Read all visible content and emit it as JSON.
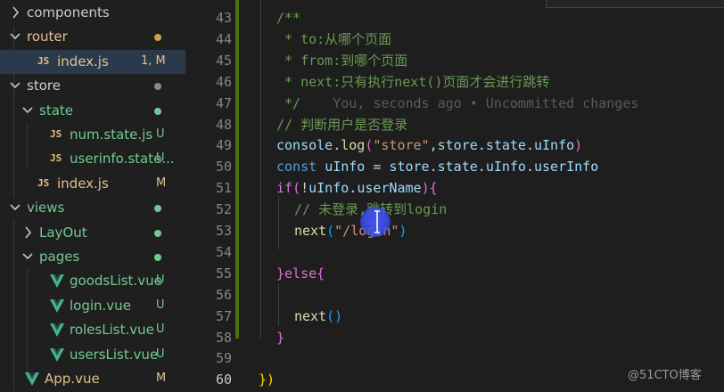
{
  "explorer": {
    "items": [
      {
        "label": "components",
        "kind": "folder",
        "expanded": false,
        "depth": 0,
        "status": "",
        "status_color": ""
      },
      {
        "label": "router",
        "kind": "folder",
        "expanded": true,
        "depth": 0,
        "status": "dot",
        "status_color": "#c9a44a"
      },
      {
        "label": "index.js",
        "kind": "js",
        "depth": 1,
        "status": "1, M",
        "status_color": "#e2c08d",
        "active": true
      },
      {
        "label": "store",
        "kind": "folder",
        "expanded": true,
        "depth": 0,
        "status": "dot",
        "status_color": "#8a8a7a"
      },
      {
        "label": "state",
        "kind": "folder",
        "expanded": true,
        "depth": 1,
        "status": "dot",
        "status_color": "#73c991"
      },
      {
        "label": "num.state.js",
        "kind": "js",
        "depth": 2,
        "status": "U",
        "status_color": "#73c991"
      },
      {
        "label": "userinfo.state...",
        "kind": "js",
        "depth": 2,
        "status": "U",
        "status_color": "#73c991"
      },
      {
        "label": "index.js",
        "kind": "js",
        "depth": 1,
        "status": "M",
        "status_color": "#e2c08d"
      },
      {
        "label": "views",
        "kind": "folder",
        "expanded": true,
        "depth": 0,
        "status": "dot",
        "status_color": "#73c991"
      },
      {
        "label": "LayOut",
        "kind": "folder",
        "expanded": false,
        "depth": 1,
        "status": "dot",
        "status_color": "#73c991"
      },
      {
        "label": "pages",
        "kind": "folder",
        "expanded": true,
        "depth": 1,
        "status": "dot",
        "status_color": "#73c991"
      },
      {
        "label": "goodsList.vue",
        "kind": "vue",
        "depth": 2,
        "status": "U",
        "status_color": "#73c991"
      },
      {
        "label": "login.vue",
        "kind": "vue",
        "depth": 2,
        "status": "U",
        "status_color": "#73c991"
      },
      {
        "label": "rolesList.vue",
        "kind": "vue",
        "depth": 2,
        "status": "U",
        "status_color": "#73c991"
      },
      {
        "label": "usersList.vue",
        "kind": "vue",
        "depth": 2,
        "status": "U",
        "status_color": "#73c991"
      },
      {
        "label": "App.vue",
        "kind": "vue",
        "depth": 0,
        "status": "M",
        "status_color": "#e2c08d"
      }
    ]
  },
  "editor": {
    "lines": [
      {
        "n": "43",
        "indent": 1,
        "tokens": [
          {
            "t": "/**",
            "c": "cm"
          }
        ]
      },
      {
        "n": "44",
        "indent": 1,
        "tokens": [
          {
            "t": " * to:从哪个页面",
            "c": "cm"
          }
        ]
      },
      {
        "n": "45",
        "indent": 1,
        "tokens": [
          {
            "t": " * from:到哪个页面",
            "c": "cm"
          }
        ]
      },
      {
        "n": "46",
        "indent": 1,
        "tokens": [
          {
            "t": " * next:只有执行next()页面才会进行跳转",
            "c": "cm"
          }
        ]
      },
      {
        "n": "47",
        "indent": 1,
        "tokens": [
          {
            "t": " */",
            "c": "cm"
          },
          {
            "t": "    You, seconds ago • Uncommitted changes",
            "c": "blame"
          }
        ]
      },
      {
        "n": "48",
        "indent": 1,
        "tokens": [
          {
            "t": "// 判断用户是否登录",
            "c": "cm"
          }
        ]
      },
      {
        "n": "49",
        "indent": 1,
        "tokens": [
          {
            "t": "console",
            "c": "var"
          },
          {
            "t": ".",
            "c": "pun"
          },
          {
            "t": "log",
            "c": "fn"
          },
          {
            "t": "(",
            "c": "br2"
          },
          {
            "t": "\"store\"",
            "c": "str"
          },
          {
            "t": ",",
            "c": "pun"
          },
          {
            "t": "store",
            "c": "var"
          },
          {
            "t": ".",
            "c": "pun"
          },
          {
            "t": "state",
            "c": "var"
          },
          {
            "t": ".",
            "c": "pun"
          },
          {
            "t": "uInfo",
            "c": "var"
          },
          {
            "t": ")",
            "c": "br2"
          }
        ]
      },
      {
        "n": "50",
        "indent": 1,
        "tokens": [
          {
            "t": "const ",
            "c": "kw"
          },
          {
            "t": "uInfo",
            "c": "var"
          },
          {
            "t": " = ",
            "c": "pun"
          },
          {
            "t": "store",
            "c": "var"
          },
          {
            "t": ".",
            "c": "pun"
          },
          {
            "t": "state",
            "c": "var"
          },
          {
            "t": ".",
            "c": "pun"
          },
          {
            "t": "uInfo",
            "c": "var"
          },
          {
            "t": ".",
            "c": "pun"
          },
          {
            "t": "userInfo",
            "c": "var"
          }
        ]
      },
      {
        "n": "51",
        "indent": 1,
        "tokens": [
          {
            "t": "if",
            "c": "br2"
          },
          {
            "t": "(",
            "c": "br2"
          },
          {
            "t": "!",
            "c": "pun"
          },
          {
            "t": "uInfo",
            "c": "var"
          },
          {
            "t": ".",
            "c": "pun"
          },
          {
            "t": "userName",
            "c": "var"
          },
          {
            "t": ")",
            "c": "br2"
          },
          {
            "t": "{",
            "c": "br2"
          }
        ]
      },
      {
        "n": "52",
        "indent": 2,
        "tokens": [
          {
            "t": "// 未登录,跳转到login",
            "c": "cm"
          }
        ]
      },
      {
        "n": "53",
        "indent": 2,
        "tokens": [
          {
            "t": "next",
            "c": "fn"
          },
          {
            "t": "(",
            "c": "br3"
          },
          {
            "t": "\"/login\"",
            "c": "str"
          },
          {
            "t": ")",
            "c": "br3"
          }
        ]
      },
      {
        "n": "54",
        "indent": 2,
        "tokens": []
      },
      {
        "n": "55",
        "indent": 1,
        "tokens": [
          {
            "t": "}",
            "c": "br2"
          },
          {
            "t": "else",
            "c": "br2"
          },
          {
            "t": "{",
            "c": "br2"
          }
        ]
      },
      {
        "n": "56",
        "indent": 2,
        "tokens": []
      },
      {
        "n": "57",
        "indent": 2,
        "tokens": [
          {
            "t": "next",
            "c": "fn"
          },
          {
            "t": "()",
            "c": "br3"
          }
        ]
      },
      {
        "n": "58",
        "indent": 1,
        "tokens": [
          {
            "t": "}",
            "c": "br2"
          }
        ]
      },
      {
        "n": "59",
        "indent": 0,
        "tokens": []
      },
      {
        "n": "60",
        "indent": 0,
        "tokens": [
          {
            "t": "}",
            "c": "br1"
          },
          {
            "t": ")",
            "c": "br1"
          }
        ]
      }
    ]
  },
  "watermark": {
    "text": "@51CTO博客"
  },
  "colors": {
    "modified_bar": "#587c0c",
    "cursor": "#4a5cff",
    "active_row": "#2b3a4a"
  }
}
